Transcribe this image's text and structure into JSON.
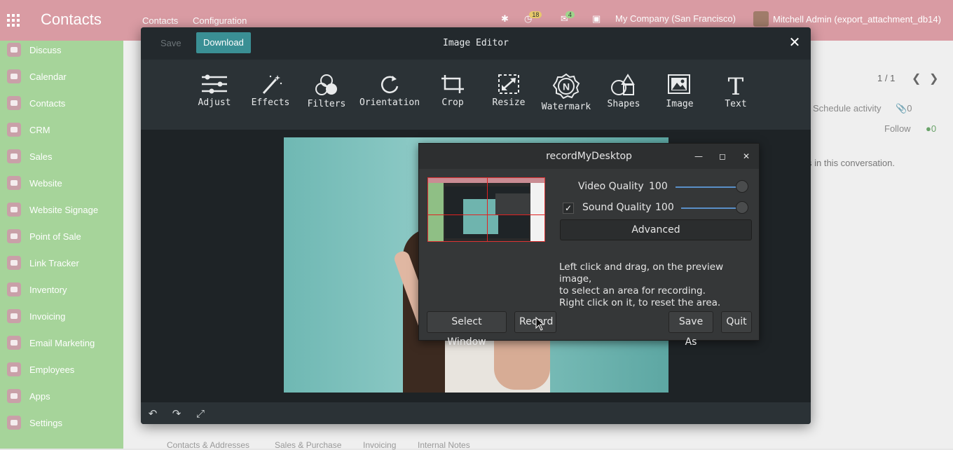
{
  "app": {
    "title": "Contacts",
    "menu": [
      "Contacts",
      "Configuration"
    ],
    "badge_activity": "18",
    "badge_messages": "4",
    "company": "My Company (San Francisco)",
    "user": "Mitchell Admin (export_attachment_db14)"
  },
  "sidebar": {
    "items": [
      {
        "label": "Discuss"
      },
      {
        "label": "Calendar"
      },
      {
        "label": "Contacts"
      },
      {
        "label": "CRM"
      },
      {
        "label": "Sales"
      },
      {
        "label": "Website"
      },
      {
        "label": "Website Signage"
      },
      {
        "label": "Point of Sale"
      },
      {
        "label": "Link Tracker"
      },
      {
        "label": "Inventory"
      },
      {
        "label": "Invoicing"
      },
      {
        "label": "Email Marketing"
      },
      {
        "label": "Employees"
      },
      {
        "label": "Apps"
      },
      {
        "label": "Settings"
      }
    ]
  },
  "background": {
    "pager": "1 / 1",
    "schedule_activity": "Schedule activity",
    "attachments_count": "0",
    "follow": "Follow",
    "followers_count": "0",
    "conversation_text": "s in this conversation.",
    "bottom_tabs": [
      "Contacts & Addresses",
      "Sales & Purchase",
      "Invoicing",
      "Internal Notes"
    ]
  },
  "editor": {
    "title": "Image Editor",
    "save_label": "Save",
    "download_label": "Download",
    "tools": [
      {
        "label": "Adjust",
        "icon": "sliders-icon"
      },
      {
        "label": "Effects",
        "icon": "magic-wand-icon"
      },
      {
        "label": "Filters",
        "icon": "filters-icon"
      },
      {
        "label": "Orientation",
        "icon": "rotate-icon"
      },
      {
        "label": "Crop",
        "icon": "crop-icon"
      },
      {
        "label": "Resize",
        "icon": "resize-icon"
      },
      {
        "label": "Watermark",
        "icon": "watermark-icon"
      },
      {
        "label": "Shapes",
        "icon": "shapes-icon"
      },
      {
        "label": "Image",
        "icon": "image-icon"
      },
      {
        "label": "Text",
        "icon": "text-icon"
      }
    ]
  },
  "recorder": {
    "title": "recordMyDesktop",
    "video_quality_label": "Video Quality",
    "video_quality_value": "100",
    "sound_quality_label": "Sound Quality",
    "sound_quality_value": "100",
    "sound_enabled": true,
    "advanced_label": "Advanced",
    "help_lines": [
      "Left click and drag, on the preview image,",
      "to select an area for recording.",
      "Right click on it, to reset the area."
    ],
    "select_window_label": "Select Window",
    "record_label": "Record",
    "save_as_label": "Save As",
    "quit_label": "Quit"
  },
  "colors": {
    "topbar": "#d99ba3",
    "sidebar": "#a6d49a",
    "download_button": "#3a8f94",
    "editor_bg": "#1e2326"
  }
}
